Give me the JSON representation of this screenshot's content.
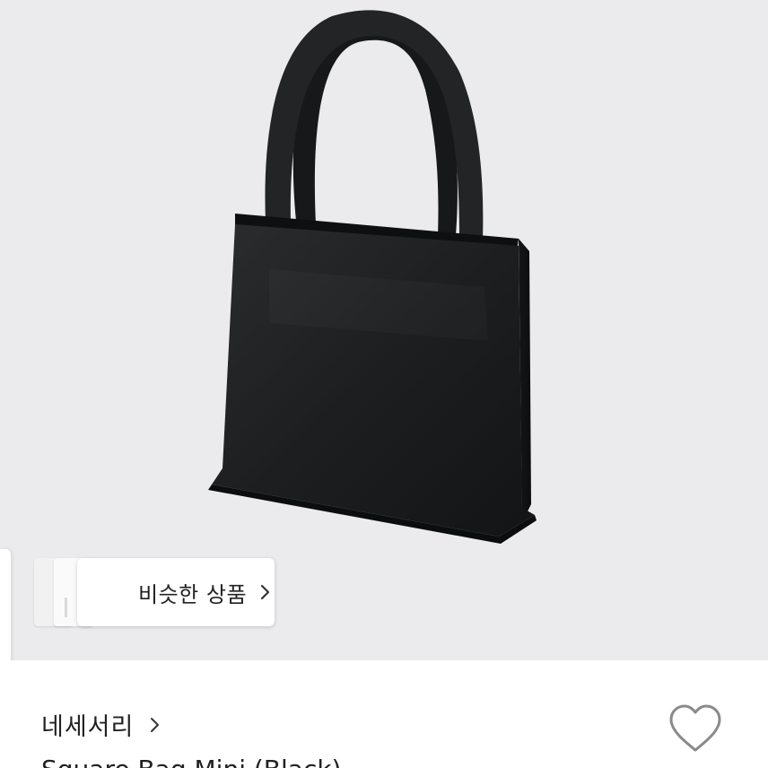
{
  "hero": {
    "image_alt": "black leather mini tote bag",
    "background_color": "#ebebed",
    "bag_color": "#1b1d1f"
  },
  "similar": {
    "label": "비슷한 상품",
    "chevron_icon": "chevron-right-icon"
  },
  "brand": {
    "name": "네세서리",
    "chevron_icon": "chevron-right-icon"
  },
  "wishlist": {
    "icon": "heart-outline-icon"
  },
  "product": {
    "name": "Square Bag Mini (Black)"
  }
}
